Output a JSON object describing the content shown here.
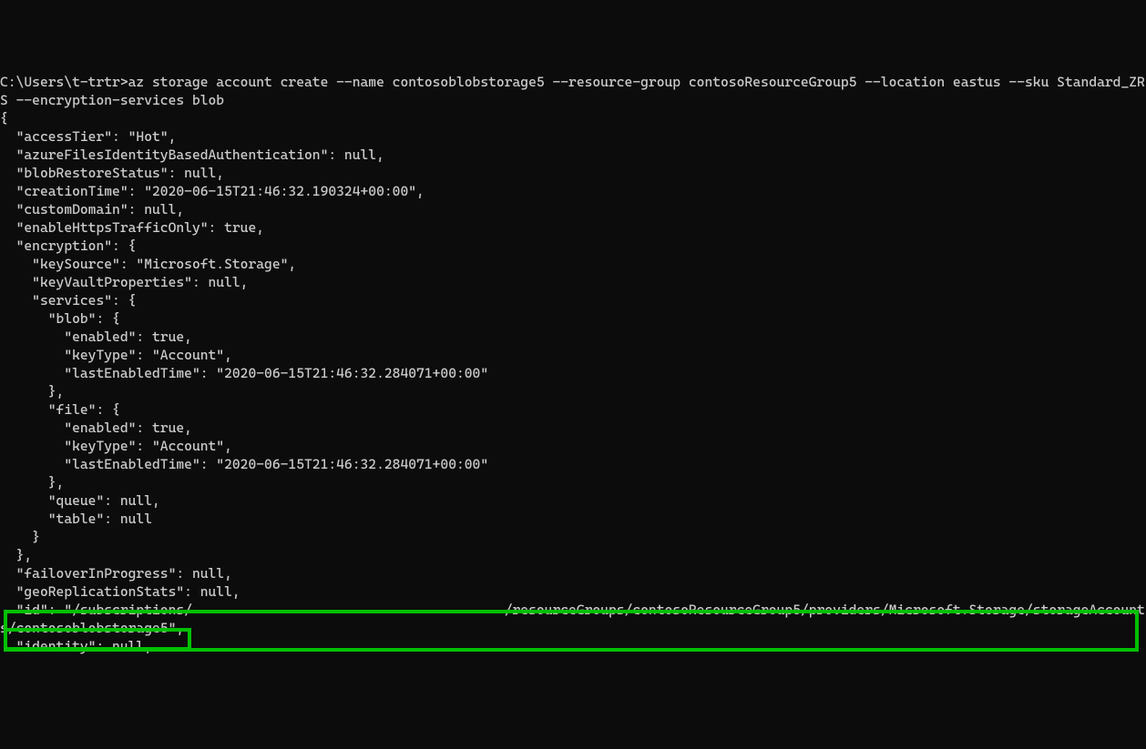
{
  "terminal": {
    "prompt": "C:\\Users\\t-trtr>",
    "command": "az storage account create --name contosoblobstorage5 --resource-group contosoResourceGroup5 --location eastus --sku Standard_ZRS --encryption-services blob",
    "output": {
      "open_brace": "{",
      "accessTier": "  \"accessTier\": \"Hot\",",
      "azureFiles": "  \"azureFilesIdentityBasedAuthentication\": null,",
      "blobRestore": "  \"blobRestoreStatus\": null,",
      "creationTime": "  \"creationTime\": \"2020-06-15T21:46:32.190324+00:00\",",
      "customDomain": "  \"customDomain\": null,",
      "enableHttps": "  \"enableHttpsTrafficOnly\": true,",
      "encryption": "  \"encryption\": {",
      "keySource": "    \"keySource\": \"Microsoft.Storage\",",
      "keyVault": "    \"keyVaultProperties\": null,",
      "services": "    \"services\": {",
      "blob": "      \"blob\": {",
      "blobEnabled": "        \"enabled\": true,",
      "blobKeyType": "        \"keyType\": \"Account\",",
      "blobLastEnabled": "        \"lastEnabledTime\": \"2020-06-15T21:46:32.284071+00:00\"",
      "blobClose": "      },",
      "file": "      \"file\": {",
      "fileEnabled": "        \"enabled\": true,",
      "fileKeyType": "        \"keyType\": \"Account\",",
      "fileLastEnabled": "        \"lastEnabledTime\": \"2020-06-15T21:46:32.284071+00:00\"",
      "fileClose": "      },",
      "queue": "      \"queue\": null,",
      "table": "      \"table\": null",
      "servicesClose": "    }",
      "encryptionClose": "  },",
      "failover": "  \"failoverInProgress\": null,",
      "geoRepl": "  \"geoReplicationStats\": null,",
      "id_part1": "  \"id\": \"/subscriptions/                                       /resourceGroups/contosoResourceGroup5/providers/Microsoft.Storage/storageAccounts/contosoblobstorage5\",",
      "identity": "  \"identity\": null,"
    }
  }
}
